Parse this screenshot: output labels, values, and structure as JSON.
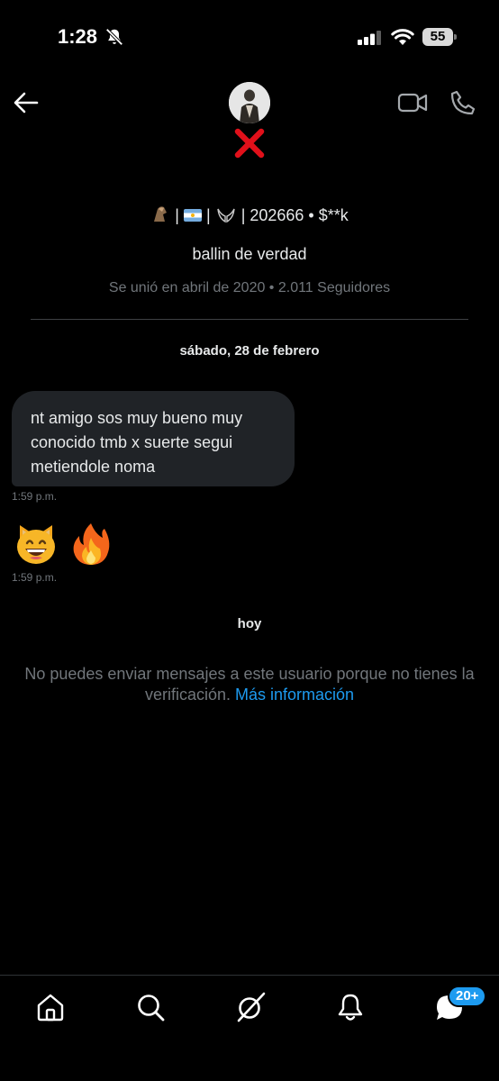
{
  "status_bar": {
    "time": "1:28",
    "battery": "55"
  },
  "profile": {
    "name_parts": [
      "|",
      "|",
      "| 202666 • $**k"
    ],
    "bio": "ballin de verdad",
    "joined": "Se unió en abril de 2020 • 2.011 Seguidores"
  },
  "conversation": {
    "date_separator": "sábado, 28 de febrero",
    "message": {
      "lines": [
        "nt amigo sos muy bueno muy",
        "conocido tmb x suerte segui",
        "metiendole noma"
      ],
      "time": "1:59 p.m."
    },
    "emoji_message": {
      "emojis": [
        "grinning-cat-emoji",
        "fire-emoji"
      ],
      "time": "1:59 p.m."
    },
    "today_separator": "hoy",
    "notice": {
      "text": "No puedes enviar mensajes a este usuario porque no tienes la verificación. ",
      "link": "Más información"
    }
  },
  "nav": {
    "items": [
      "home-icon",
      "search-icon",
      "grok-icon",
      "bell-icon",
      "messages-icon"
    ],
    "messages_badge": "20+"
  },
  "colors": {
    "background": "#000000",
    "bubble": "#202327",
    "muted_text": "#71767b",
    "link": "#1d9bf0",
    "badge": "#1d9bf0",
    "blocked_x": "#e0101a"
  }
}
